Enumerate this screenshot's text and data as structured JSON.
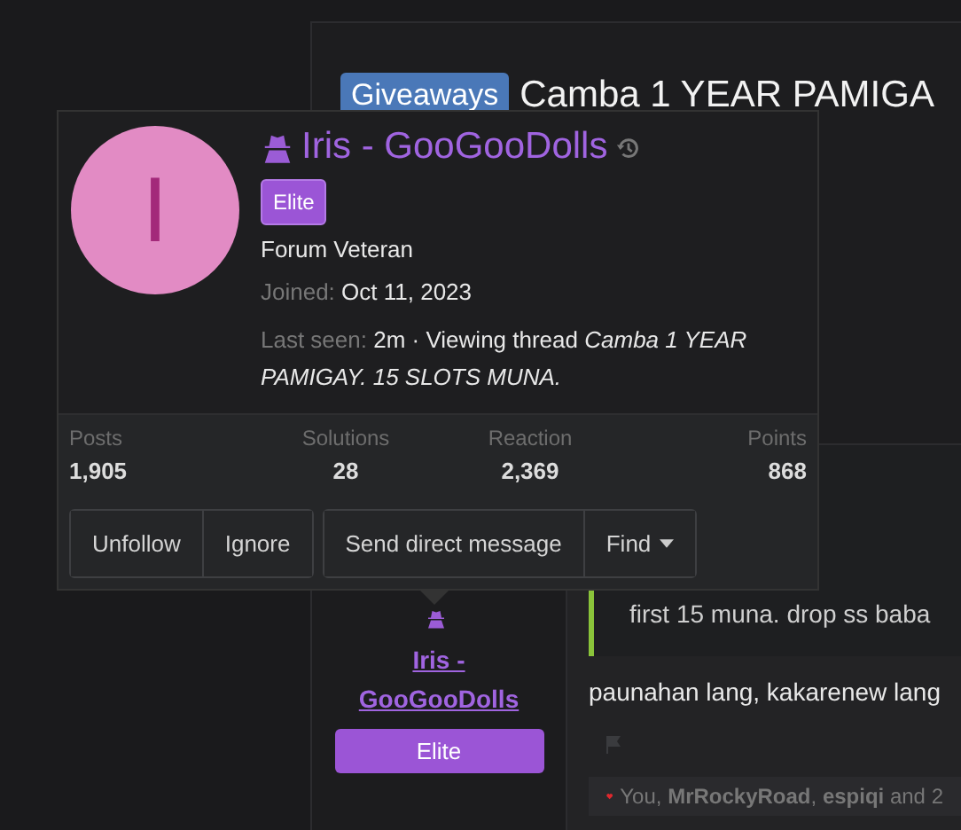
{
  "thread": {
    "prefix": "Giveaways",
    "title": "Camba 1 YEAR PAMIGA"
  },
  "post": {
    "author": "Iris - GooGooDolls",
    "badge": "Elite",
    "quote": "first 15 muna. drop ss baba",
    "message": "paunahan lang, kakarenew lang",
    "reactions": "You, **MrRockyRoad**, **espiqi** and 2"
  },
  "profile_card": {
    "avatar_letter": "I",
    "name": "Iris - GooGooDolls",
    "badge": "Elite",
    "user_title": "Forum Veteran",
    "joined_label": "Joined:",
    "joined": "Oct 11, 2023",
    "last_seen_label": "Last seen:",
    "last_seen": "2m · Viewing thread *Camba 1 YEAR PAMIGAY. 15 SLOTS MUNA.*",
    "stats": [
      {
        "label": "Posts",
        "value": "1,905"
      },
      {
        "label": "Solutions",
        "value": "28"
      },
      {
        "label": "Reaction",
        "value": "2,369"
      },
      {
        "label": "Points",
        "value": "868"
      }
    ],
    "button_groups": [
      [
        {
          "label": "Unfollow",
          "kind": "plain"
        },
        {
          "label": "Ignore",
          "kind": "plain"
        }
      ],
      [
        {
          "label": "Send direct message",
          "kind": "plain"
        },
        {
          "label": "Find",
          "kind": "dropdown"
        }
      ]
    ]
  }
}
